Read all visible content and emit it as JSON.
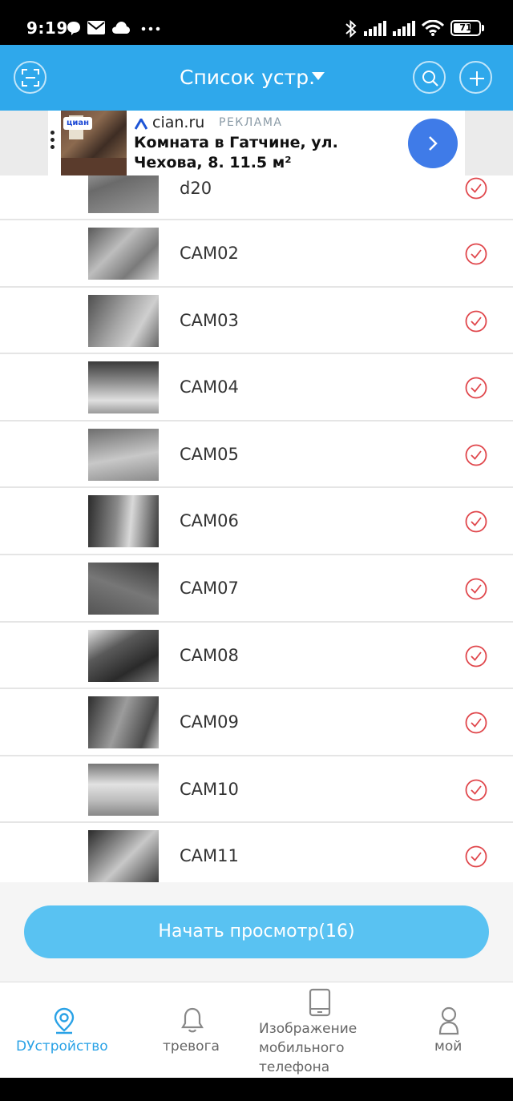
{
  "status_bar": {
    "time": "9:19",
    "battery": "71",
    "battery_level": 0.71,
    "icons": [
      "chat-bubble-icon",
      "mail-icon",
      "cloud-icon",
      "more-dots-icon",
      "bluetooth-icon",
      "signal-icon",
      "signal-icon",
      "wifi-icon",
      "battery-icon"
    ]
  },
  "header": {
    "title": "Список устр.",
    "left_icon": "scan-icon",
    "right_icons": [
      "search-icon",
      "add-icon"
    ],
    "color": "#2fa8eb"
  },
  "ad": {
    "badge": "циан",
    "brand": "cian.ru",
    "label": "РЕКЛАМА",
    "title": "Комната в Гатчине, ул. Чехова, 8. 11.5 м²"
  },
  "devices": [
    {
      "name": "d20"
    },
    {
      "name": "CAM02"
    },
    {
      "name": "CAM03"
    },
    {
      "name": "CAM04"
    },
    {
      "name": "CAM05"
    },
    {
      "name": "CAM06"
    },
    {
      "name": "CAM07"
    },
    {
      "name": "CAM08"
    },
    {
      "name": "CAM09"
    },
    {
      "name": "CAM10"
    },
    {
      "name": "CAM11"
    }
  ],
  "check_color": "#e0474c",
  "start_button": "Начать просмотр(16)",
  "bottom_nav": [
    {
      "label": "DУстройство",
      "icon": "location-pin-icon",
      "active": true
    },
    {
      "label": "тревога",
      "icon": "bell-icon",
      "active": false
    },
    {
      "label": "Изображение мобильного телефона",
      "icon": "phone-icon",
      "active": false
    },
    {
      "label": "мой",
      "icon": "user-icon",
      "active": false
    }
  ],
  "accent": "#2aa2e6"
}
